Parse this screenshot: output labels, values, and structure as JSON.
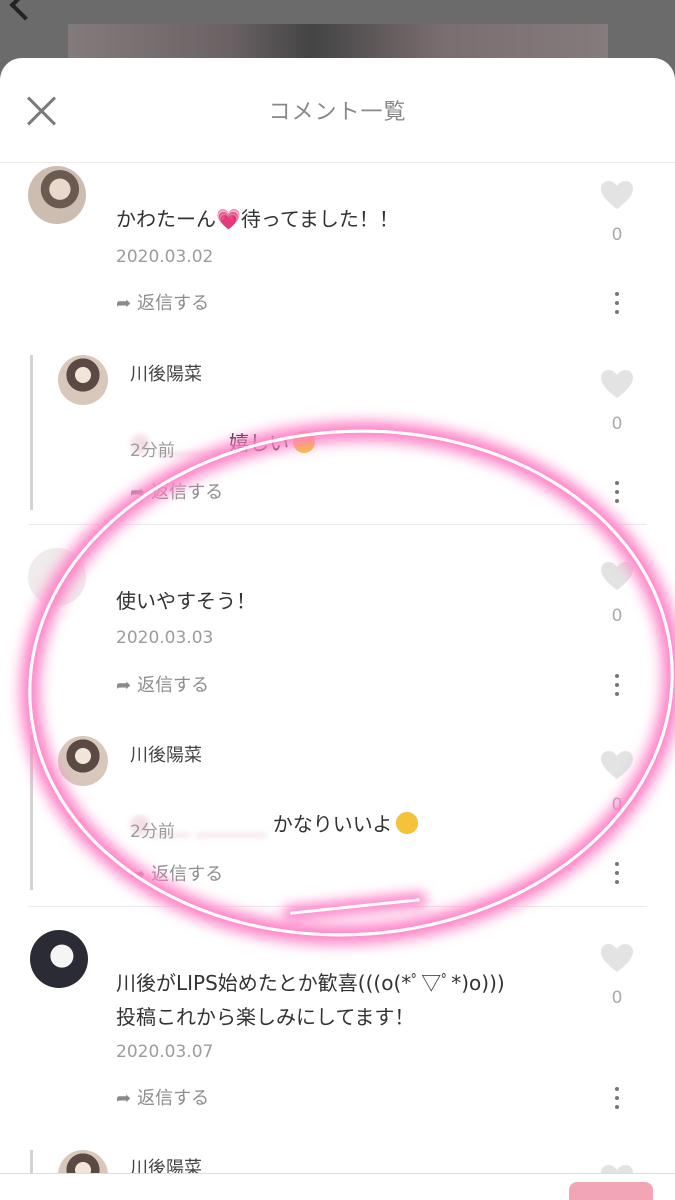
{
  "header": {
    "title": "コメント一覧"
  },
  "colors": {
    "accent_pink": "#ff7fc7",
    "mention": "#e2a7b7"
  },
  "comments": [
    {
      "text": "かわたーん💗待ってました！！",
      "date": "2020.03.02",
      "reply_label": "返信する",
      "likes": "0"
    },
    {
      "name": "川後陽菜",
      "text": "嬉しい",
      "time": "2分前",
      "reply_label": "返信する",
      "likes": "0"
    },
    {
      "text": "使いやすそう！",
      "date": "2020.03.03",
      "reply_label": "返信する",
      "likes": "0"
    },
    {
      "name": "川後陽菜",
      "text": "かなりいいよ",
      "time": "2分前",
      "reply_label": "返信する",
      "likes": "0"
    },
    {
      "text": "川後がLIPS始めたとか歓喜(((o(*ﾟ▽ﾟ*)o)))\n投稿これから楽しみにしてます！",
      "date": "2020.03.07",
      "reply_label": "返信する",
      "likes": "0"
    },
    {
      "name": "川後陽菜"
    }
  ],
  "icons": {
    "close": "close-icon",
    "like": "heart-icon",
    "more": "more-icon",
    "reply": "reply-arrow-icon"
  }
}
